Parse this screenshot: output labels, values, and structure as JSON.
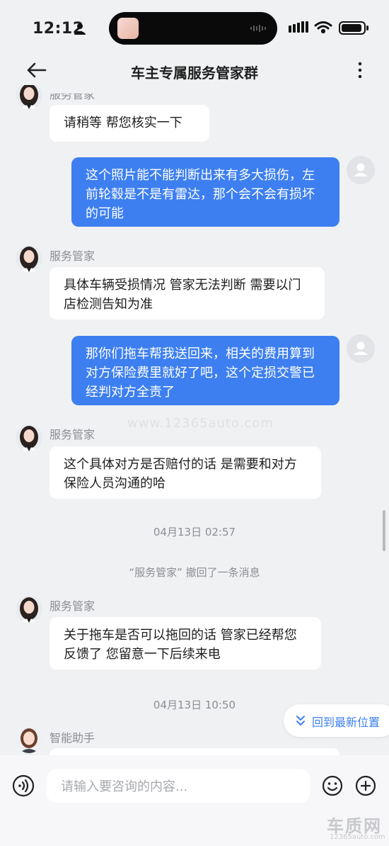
{
  "status_bar": {
    "time": "12:12"
  },
  "header": {
    "title": "车主专属服务管家群"
  },
  "messages": {
    "m0": {
      "text": "请稍等 帮您核实一下"
    },
    "m1": {
      "text": "这个照片能不能判断出来有多大损伤，左前轮毂是不是有雷达，那个会不会有损坏的可能"
    },
    "m2": {
      "sender": "服务管家",
      "text": "具体车辆受损情况 管家无法判断 需要以门店检测告知为准"
    },
    "m3": {
      "text": "那你们拖车帮我送回来，相关的费用算到对方保险费里就好了吧，这个定损交警已经判对方全责了"
    },
    "m4": {
      "sender": "服务管家",
      "text": "这个具体对方是否赔付的话 是需要和对方保险人员沟通的哈"
    },
    "t1": "04月13日 02:57",
    "recall": "“服务管家” 撤回了一条消息",
    "m5": {
      "sender": "服务管家",
      "text": "关于拖车是否可以拖回的话 管家已经帮您反馈了 您留意一下后续来电"
    },
    "t2": "04月13日 10:50",
    "m6": {
      "sender": "智能助手"
    }
  },
  "truncated_sender": "服务管家",
  "watermark": "www.12365auto.com",
  "jump_latest": {
    "label": "回到最新位置"
  },
  "input": {
    "placeholder": "请输入要咨询的内容..."
  },
  "logo": {
    "text": "车质网",
    "sub": "12365auto.com"
  },
  "colors": {
    "bubble_out": "#3d7ff0",
    "bubble_in": "#ffffff",
    "background": "#f0f1f3"
  },
  "icons": [
    "person-icon",
    "back-arrow-icon",
    "more-vertical-icon",
    "chevron-double-down-icon",
    "voice-icon",
    "emoji-icon",
    "add-circle-icon"
  ]
}
